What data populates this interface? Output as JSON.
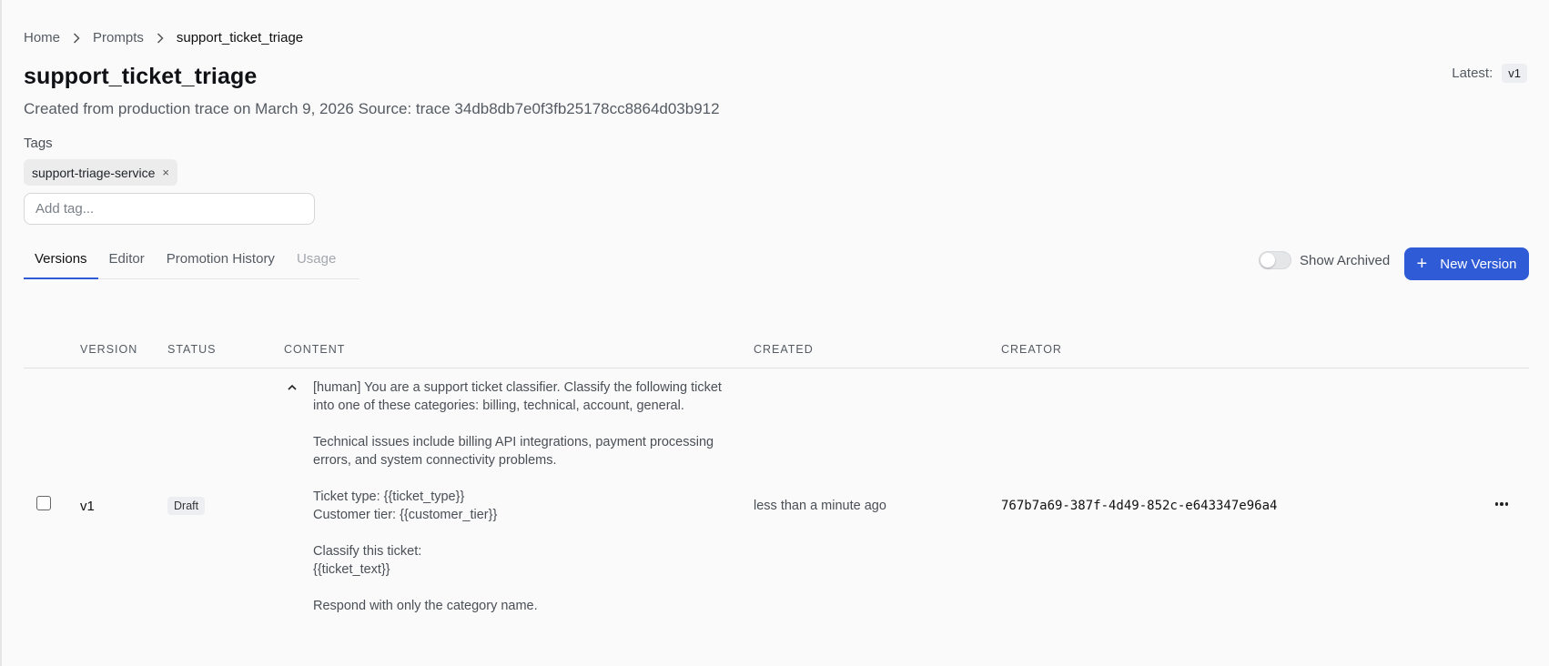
{
  "breadcrumb": {
    "items": [
      "Home",
      "Prompts",
      "support_ticket_triage"
    ]
  },
  "page": {
    "title": "support_ticket_triage",
    "subtitle": "Created from production trace on March 9, 2026 Source: trace 34db8db7e0f3fb25178cc8864d03b912",
    "latest_label": "Latest:",
    "latest_version": "v1"
  },
  "tags": {
    "label": "Tags",
    "items": [
      "support-triage-service"
    ],
    "remove_glyph": "×",
    "input_placeholder": "Add tag..."
  },
  "tabs": [
    {
      "label": "Versions",
      "active": true
    },
    {
      "label": "Editor",
      "active": false
    },
    {
      "label": "Promotion History",
      "active": false
    },
    {
      "label": "Usage",
      "active": false,
      "disabled": true
    }
  ],
  "toolbar": {
    "show_archived_label": "Show Archived",
    "show_archived_on": false,
    "new_version_label": "New Version"
  },
  "table": {
    "columns": [
      "VERSION",
      "STATUS",
      "CONTENT",
      "CREATED",
      "CREATOR"
    ],
    "rows": [
      {
        "version": "v1",
        "status": "Draft",
        "content_lines": [
          "[human] You are a support ticket classifier. Classify the following ticket",
          "into one of these categories: billing, technical, account, general.",
          "",
          "Technical issues include billing API integrations, payment processing",
          "errors, and system connectivity problems.",
          "",
          "Ticket type: {{ticket_type}}",
          "Customer tier: {{customer_tier}}",
          "",
          "Classify this ticket:",
          "{{ticket_text}}",
          "",
          "Respond with only the category name."
        ],
        "created": "less than a minute ago",
        "creator": "767b7a69-387f-4d49-852c-e643347e96a4"
      }
    ]
  },
  "colors": {
    "accent": "#2f5bd6",
    "background": "#fafafa"
  }
}
